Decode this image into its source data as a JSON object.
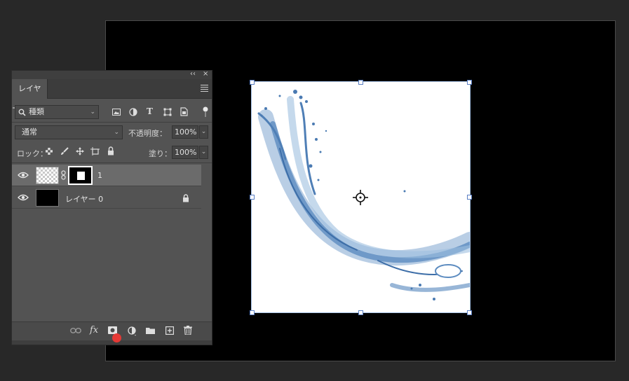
{
  "panel": {
    "tab_label": "レイヤー",
    "collapse_glyph": "‹‹",
    "close_glyph": "×",
    "filter": {
      "kind_label": "種類",
      "filter_icons": [
        "image-filter-icon",
        "adjustment-filter-icon",
        "type-filter-icon",
        "shape-filter-icon",
        "smart-object-filter-icon"
      ]
    },
    "blend_mode": "通常",
    "opacity_label": "不透明度：",
    "opacity_value": "100%",
    "lock_label": "ロック：",
    "fill_label": "塗り：",
    "fill_value": "100%"
  },
  "layers": [
    {
      "name": "1",
      "selected": true,
      "has_mask": true,
      "visible": true
    },
    {
      "name": "レイヤー 0",
      "selected": false,
      "locked": true,
      "visible": true
    }
  ],
  "bottom_toolbar": {
    "fx_label": "fx",
    "icons": [
      "link-layers-icon",
      "fx-icon",
      "add-mask-icon",
      "adjustment-layer-icon",
      "new-group-icon",
      "new-layer-icon",
      "delete-layer-icon"
    ]
  },
  "colors": {
    "app_bg": "#282828",
    "panel_bg": "#535353",
    "selected_layer": "#6b6b6b",
    "canvas": "#000000",
    "highlight_dot": "#e53935",
    "transform_handle_border": "#5a7fc4"
  }
}
